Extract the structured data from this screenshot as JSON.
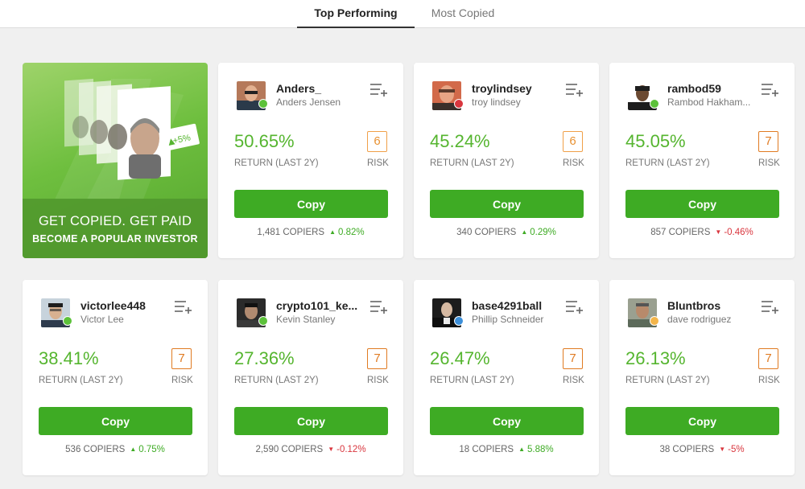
{
  "tabs": [
    {
      "label": "Top Performing",
      "active": true
    },
    {
      "label": "Most Copied",
      "active": false
    }
  ],
  "promo": {
    "title": "GET COPIED. GET PAID",
    "subtitle": "BECOME A POPULAR INVESTOR",
    "badge": "+5%"
  },
  "cards": [
    {
      "username": "Anders_",
      "fullname": "Anders Jensen",
      "return": "50.65%",
      "return_label": "RETURN (LAST 2Y)",
      "risk": "6",
      "risk_label": "RISK",
      "copy_label": "Copy",
      "copiers": "1,481 COPIERS",
      "change": "0.82%",
      "trend": "up",
      "risk_color": "#e89233"
    },
    {
      "username": "troylindsey",
      "fullname": "troy lindsey",
      "return": "45.24%",
      "return_label": "RETURN (LAST 2Y)",
      "risk": "6",
      "risk_label": "RISK",
      "copy_label": "Copy",
      "copiers": "340 COPIERS",
      "change": "0.29%",
      "trend": "up",
      "risk_color": "#e89233"
    },
    {
      "username": "rambod59",
      "fullname": "Rambod Hakham...",
      "return": "45.05%",
      "return_label": "RETURN (LAST 2Y)",
      "risk": "7",
      "risk_label": "RISK",
      "copy_label": "Copy",
      "copiers": "857 COPIERS",
      "change": "-0.46%",
      "trend": "down",
      "risk_color": "#e07b22"
    },
    {
      "username": "victorlee448",
      "fullname": "Victor Lee",
      "return": "38.41%",
      "return_label": "RETURN (LAST 2Y)",
      "risk": "7",
      "risk_label": "RISK",
      "copy_label": "Copy",
      "copiers": "536 COPIERS",
      "change": "0.75%",
      "trend": "up",
      "risk_color": "#e07b22"
    },
    {
      "username": "crypto101_ke...",
      "fullname": "Kevin Stanley",
      "return": "27.36%",
      "return_label": "RETURN (LAST 2Y)",
      "risk": "7",
      "risk_label": "RISK",
      "copy_label": "Copy",
      "copiers": "2,590 COPIERS",
      "change": "-0.12%",
      "trend": "down",
      "risk_color": "#e07b22"
    },
    {
      "username": "base4291ball",
      "fullname": "Phillip Schneider",
      "return": "26.47%",
      "return_label": "RETURN (LAST 2Y)",
      "risk": "7",
      "risk_label": "RISK",
      "copy_label": "Copy",
      "copiers": "18 COPIERS",
      "change": "5.88%",
      "trend": "up",
      "risk_color": "#e07b22"
    },
    {
      "username": "Bluntbros",
      "fullname": "dave rodriguez",
      "return": "26.13%",
      "return_label": "RETURN (LAST 2Y)",
      "risk": "7",
      "risk_label": "RISK",
      "copy_label": "Copy",
      "copiers": "38 COPIERS",
      "change": "-5%",
      "trend": "down",
      "risk_color": "#e07b22"
    }
  ],
  "colors": {
    "accent_green": "#3eab24",
    "return_green": "#55b52f",
    "negative_red": "#d9363e",
    "risk_orange": "#e89233"
  }
}
